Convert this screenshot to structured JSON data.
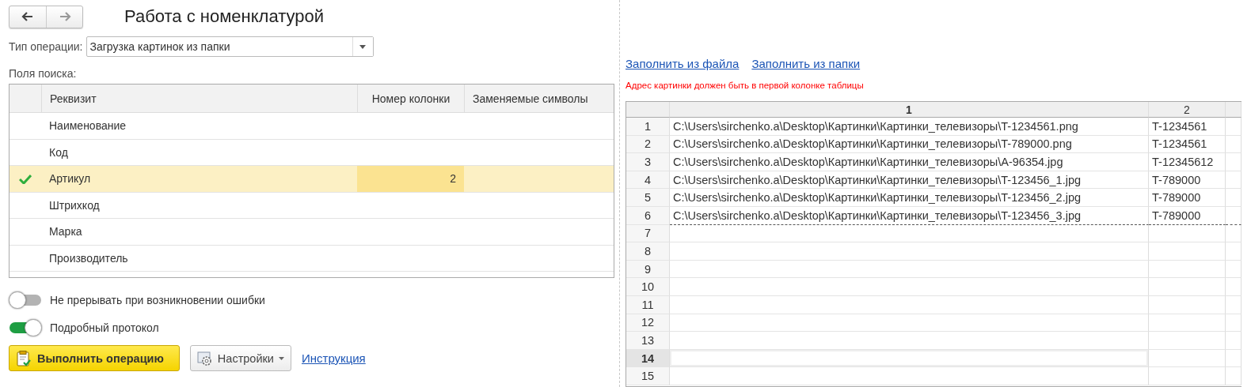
{
  "title": "Работа с номенклатурой",
  "operation": {
    "label": "Тип операции:",
    "value": "Загрузка картинок из папки"
  },
  "search_fields": {
    "label": "Поля поиска:",
    "columns": [
      "Реквизит",
      "Номер колонки",
      "Заменяемые символы"
    ],
    "rows": [
      {
        "name": "Наименование",
        "checked": false,
        "selected": false
      },
      {
        "name": "Код",
        "checked": false,
        "selected": false
      },
      {
        "name": "Артикул",
        "column": "2",
        "checked": true,
        "selected": true
      },
      {
        "name": "Штрихкод",
        "checked": false,
        "selected": false
      },
      {
        "name": "Марка",
        "checked": false,
        "selected": false
      },
      {
        "name": "Производитель",
        "checked": false,
        "selected": false
      }
    ]
  },
  "toggles": [
    {
      "label": "Не прерывать при возникновении ошибки",
      "on": false
    },
    {
      "label": "Подробный протокол",
      "on": true
    }
  ],
  "buttons": [
    {
      "kind": "primary",
      "label": "Выполнить операцию"
    },
    {
      "kind": "menu",
      "label": "Настройки"
    },
    {
      "kind": "link",
      "label": "Инструкция"
    }
  ],
  "fill_links": [
    "Заполнить из файла",
    "Заполнить из папки"
  ],
  "hint": "Адрес картинки должен быть в первой колонке таблицы",
  "sheet": {
    "columns": [
      "1",
      "2"
    ],
    "rows": [
      {
        "number": "1",
        "cells": [
          "C:\\Users\\sirchenko.a\\Desktop\\Картинки\\Картинки_телевизоры\\T-1234561.png",
          "T-1234561"
        ],
        "selected": false
      },
      {
        "number": "2",
        "cells": [
          "C:\\Users\\sirchenko.a\\Desktop\\Картинки\\Картинки_телевизоры\\T-789000.png",
          "T-1234561"
        ],
        "selected": false
      },
      {
        "number": "3",
        "cells": [
          "C:\\Users\\sirchenko.a\\Desktop\\Картинки\\Картинки_телевизоры\\A-96354.jpg",
          "T-12345612"
        ],
        "selected": false
      },
      {
        "number": "4",
        "cells": [
          "C:\\Users\\sirchenko.a\\Desktop\\Картинки\\Картинки_телевизоры\\T-123456_1.jpg",
          "T-789000"
        ],
        "selected": false
      },
      {
        "number": "5",
        "cells": [
          "C:\\Users\\sirchenko.a\\Desktop\\Картинки\\Картинки_телевизоры\\T-123456_2.jpg",
          "T-789000"
        ],
        "selected": false
      },
      {
        "number": "6",
        "cells": [
          "C:\\Users\\sirchenko.a\\Desktop\\Картинки\\Картинки_телевизоры\\T-123456_3.jpg",
          "T-789000"
        ],
        "selected": false
      },
      {
        "number": "7",
        "selected": false
      },
      {
        "number": "8",
        "selected": false
      },
      {
        "number": "9",
        "selected": false
      },
      {
        "number": "10",
        "selected": false
      },
      {
        "number": "11",
        "selected": false
      },
      {
        "number": "12",
        "selected": false
      },
      {
        "number": "13",
        "selected": false
      },
      {
        "number": "14",
        "selected": true
      },
      {
        "number": "15",
        "selected": false
      }
    ]
  }
}
